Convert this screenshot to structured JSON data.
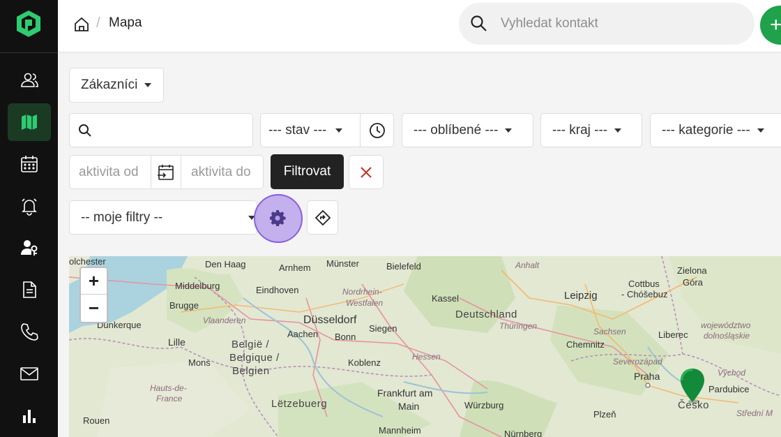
{
  "header": {
    "breadcrumb_title": "Mapa",
    "breadcrumb_sep": "/",
    "search_placeholder": "Vyhledat kontakt",
    "add_label": "+"
  },
  "sidebar": {
    "items": [
      {
        "icon": "users-icon"
      },
      {
        "icon": "map-icon",
        "active": true
      },
      {
        "icon": "calendar-icon"
      },
      {
        "icon": "alarm-bell-icon"
      },
      {
        "icon": "user-key-icon"
      },
      {
        "icon": "document-icon"
      },
      {
        "icon": "phone-icon"
      },
      {
        "icon": "mail-icon"
      },
      {
        "icon": "bar-chart-icon"
      }
    ]
  },
  "filters": {
    "type_select": "Zákazníci",
    "search_value": "",
    "state_select": "--- stav ---",
    "favorite_select": "--- oblíbené ---",
    "region_select": "--- kraj ---",
    "category_select": "--- kategorie ---",
    "activity_from_placeholder": "aktivita od",
    "activity_to_placeholder": "aktivita do",
    "filter_button": "Filtrovat",
    "my_filters_select": "-- moje filtry --"
  },
  "map": {
    "zoom_in": "+",
    "zoom_out": "−",
    "labels": {
      "colchester": "olchester",
      "den_haag": "Den Haag",
      "arnhem": "Arnhem",
      "munster": "Münster",
      "bielefeld": "Bielefeld",
      "anhalt": "Anhalt",
      "zielona": "Zielona",
      "gora": "Góra",
      "middelburg": "Middelburg",
      "eindhoven": "Eindhoven",
      "nordrhein": "Nordrhein-",
      "westfalen": "Westfalen",
      "kassel": "Kassel",
      "leipzig": "Leipzig",
      "cottbus": "Cottbus",
      "chosebuz": "- Chóšebuz",
      "brugge": "Brugge",
      "vlaanderen": "Vlaanderen",
      "dusseldorf": "Düsseldorf",
      "deutschland": "Deutschland",
      "thuringen": "Thüringen",
      "dunkerque": "Dunkerque",
      "aachen": "Aachen",
      "siegen": "Siegen",
      "sachsen": "Sachsen",
      "wojewodztwo": "województwo",
      "dolnoslaskie": "dolnośląskie",
      "lille": "Lille",
      "belgie": "België /",
      "belgique": "Belgique /",
      "belgien": "Belgien",
      "bonn": "Bonn",
      "chemnitz": "Chemnitz",
      "liberec": "Liberec",
      "mons": "Mons",
      "koblenz": "Koblenz",
      "hessen": "Hessen",
      "severozapad": "Severozápad",
      "hauts": "Hauts-de-",
      "france": "France",
      "frankfurt": "Frankfurt am",
      "main": "Main",
      "praha": "Praha",
      "pardubice": "Pardubice",
      "letzebuerg": "Lëtzebuerg",
      "wurzburg": "Würzburg",
      "cesko": "Česko",
      "rouen": "Rouen",
      "mannheim": "Mannheim",
      "nurnberg": "Nürnberg",
      "plzen": "Plzeň",
      "stredni": "Střední M",
      "vychod": "Východ"
    }
  },
  "colors": {
    "sidebar_bg": "#111111",
    "accent_green": "#1fa24a",
    "highlight": "#9a78e6",
    "clear_red": "#c0392b"
  }
}
